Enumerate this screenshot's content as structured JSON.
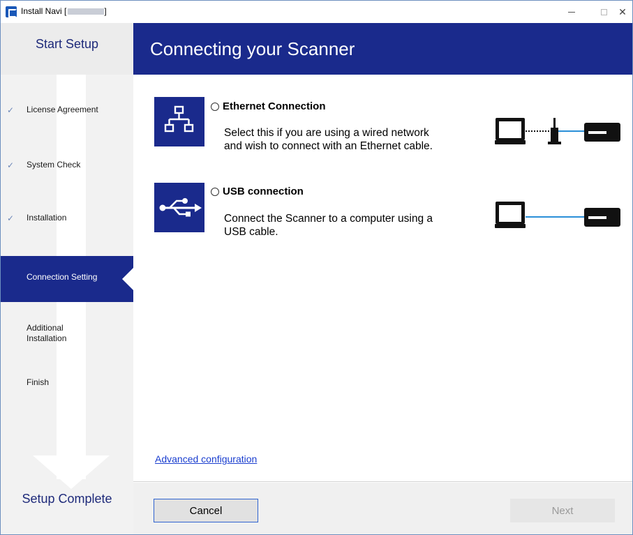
{
  "window": {
    "title": "Install Navi [",
    "title_suffix": "]",
    "controls": {
      "minimize_icon": "minimize-icon",
      "maximize_icon": "maximize-icon",
      "close_symbol": "✕"
    }
  },
  "sidebar": {
    "start_label": "Start Setup",
    "end_label": "Setup Complete",
    "check_symbol": "✓",
    "steps": [
      {
        "label": "License Agreement",
        "state": "done"
      },
      {
        "label": "System Check",
        "state": "done"
      },
      {
        "label": "Installation",
        "state": "done"
      },
      {
        "label": "Connection Setting",
        "state": "active"
      },
      {
        "label_line1": "Additional",
        "label_line2": "Installation",
        "state": "pending"
      },
      {
        "label": "Finish",
        "state": "pending"
      }
    ]
  },
  "header": {
    "title": "Connecting your Scanner"
  },
  "options": [
    {
      "label": "Ethernet Connection",
      "desc_line1": "Select this if you are using a wired network",
      "desc_line2": "and wish to connect with an Ethernet cable.",
      "icon": "network-icon",
      "selected": false
    },
    {
      "label": "USB connection",
      "desc_line1": "Connect the Scanner to a computer using a",
      "desc_line2": "USB cable.",
      "icon": "usb-icon",
      "selected": false
    }
  ],
  "links": {
    "advanced": "Advanced configuration"
  },
  "buttons": {
    "cancel": "Cancel",
    "next": "Next"
  },
  "colors": {
    "brand_navy": "#1a2a8c",
    "cable_blue": "#2a8fd8",
    "link_blue": "#1a3ecf",
    "cancel_border": "#2f63d0",
    "disabled_text": "#9a9a9a"
  }
}
